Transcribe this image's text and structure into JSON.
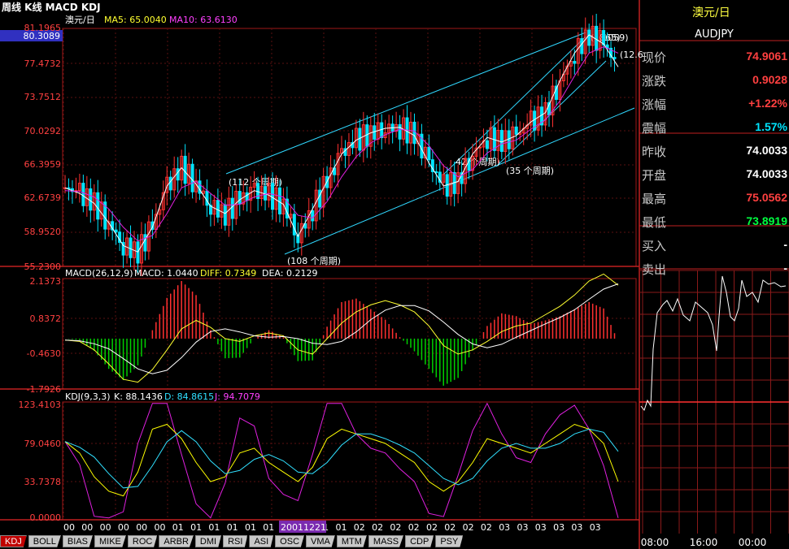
{
  "header": {
    "title": "周线 K线 MACD KDJ",
    "price_badge": "80.3089"
  },
  "colors": {
    "up": "#ff3030",
    "down": "#00e5ff",
    "grid": "#8b1a1a",
    "ma5": "#ffffff",
    "ma10": "#e020e0",
    "k": "#ffffff",
    "d": "#ffff00",
    "j": "#e020e0"
  },
  "price_panel": {
    "title": "澳元/日",
    "ma5_label": "MA5: 65.0040",
    "ma10_label": "MA10: 63.6130",
    "ticks": [
      "81.1965",
      "77.4732",
      "73.7512",
      "70.0292",
      "66.3959",
      "62.6739",
      "58.9520",
      "55.2300"
    ],
    "ylim": [
      55.23,
      81.1965
    ],
    "annotations": [
      "(112 个周期)",
      "(108 个周期)",
      "42 个周期)",
      "(35 个周期)",
      "(1865)",
      "(1059)",
      "(12.6"
    ]
  },
  "macd_panel": {
    "label": "MACD(26,12,9)",
    "macd_label": "MACD: 1.0440",
    "diff_label": "DIFF: 0.7349",
    "dea_label": "DEA: 0.2129",
    "ticks": [
      "2.1373",
      "0.8372",
      "-0.4630",
      "-1.7926"
    ],
    "ylim": [
      -1.7926,
      2.1373
    ]
  },
  "kdj_panel": {
    "label": "KDJ(9,3,3)",
    "k_label": "K: 88.1436",
    "d_label": "D: 84.8615",
    "j_label": "J: 94.7079",
    "ticks": [
      "123.4103",
      "79.0460",
      "33.7378",
      "0.0000"
    ],
    "ylim": [
      0,
      123.4103
    ]
  },
  "x_axis": {
    "labels": [
      "00",
      "00",
      "00",
      "00",
      "00",
      "00",
      "01",
      "01",
      "01",
      "01",
      "01",
      "01",
      "01",
      "01",
      "01",
      "01",
      "02",
      "02",
      "02",
      "02",
      "02",
      "02",
      "02",
      "02",
      "03",
      "03",
      "03",
      "03",
      "03",
      "03"
    ],
    "highlight": "20011221"
  },
  "tabs": [
    "KDJ",
    "BOLL",
    "BIAS",
    "MIKE",
    "ROC",
    "ARBR",
    "DMI",
    "RSI",
    "ASI",
    "OSC",
    "VMA",
    "MTM",
    "MASS",
    "CDP",
    "PSY"
  ],
  "quote": {
    "name": "澳元/日",
    "code": "AUDJPY",
    "rows": [
      {
        "k": "现价",
        "v": "74.9061",
        "c": "#ff4040"
      },
      {
        "k": "涨跌",
        "v": "0.9028",
        "c": "#ff4040"
      },
      {
        "k": "涨幅",
        "v": "+1.22%",
        "c": "#ff4040"
      },
      {
        "k": "震幅",
        "v": "1.57%",
        "c": "#00e5ff"
      },
      {
        "k": "昨收",
        "v": "74.0033",
        "c": "#ffffff"
      },
      {
        "k": "开盘",
        "v": "74.0033",
        "c": "#ffffff"
      },
      {
        "k": "最高",
        "v": "75.0562",
        "c": "#ff4040"
      },
      {
        "k": "最低",
        "v": "73.8919",
        "c": "#00ff40"
      },
      {
        "k": "买入",
        "v": "-",
        "c": "#ffffff"
      },
      {
        "k": "卖出",
        "v": "-",
        "c": "#ffffff"
      }
    ],
    "time_labels": [
      "08:00",
      "16:00",
      "00:00"
    ]
  },
  "chart_data": {
    "type": "line",
    "series": [
      {
        "name": "MA5",
        "values": [
          63.8,
          63.2,
          62.1,
          60.0,
          57.5,
          56.8,
          59.5,
          64.0,
          66.0,
          64.2,
          61.8,
          61.0,
          62.5,
          63.5,
          63.0,
          62.0,
          58.5,
          61.5,
          64.5,
          67.5,
          69.0,
          69.8,
          70.3,
          70.4,
          69.5,
          66.5,
          64.0,
          64.5,
          67.5,
          69.3,
          68.8,
          69.5,
          71.0,
          72.0,
          75.5,
          78.5,
          80.5,
          79.5,
          77.0
        ]
      },
      {
        "name": "MA10",
        "values": [
          63.5,
          63.4,
          62.8,
          61.5,
          59.5,
          58.0,
          58.6,
          61.0,
          63.8,
          64.5,
          63.2,
          61.9,
          62.0,
          62.8,
          63.2,
          62.8,
          60.8,
          60.5,
          62.3,
          65.0,
          67.2,
          68.7,
          69.6,
          70.2,
          70.0,
          68.4,
          66.2,
          65.0,
          65.8,
          67.6,
          68.6,
          69.0,
          70.2,
          71.2,
          73.3,
          76.0,
          78.5,
          79.2,
          78.5
        ]
      }
    ],
    "macd": {
      "diff": [
        -0.05,
        -0.1,
        -0.4,
        -0.9,
        -1.45,
        -1.55,
        -1.1,
        -0.4,
        0.35,
        0.65,
        0.4,
        0.0,
        -0.1,
        0.1,
        0.2,
        0.1,
        -0.4,
        -0.55,
        0.0,
        0.55,
        0.95,
        1.2,
        1.35,
        1.2,
        0.95,
        0.45,
        -0.25,
        -0.55,
        -0.4,
        -0.1,
        0.25,
        0.45,
        0.55,
        0.85,
        1.15,
        1.55,
        2.05,
        2.3,
        1.9
      ]
    },
    "kdj": {
      "k": [
        82,
        70,
        45,
        30,
        25,
        50,
        95,
        100,
        85,
        60,
        40,
        45,
        70,
        75,
        60,
        50,
        40,
        55,
        85,
        95,
        90,
        85,
        80,
        70,
        60,
        40,
        30,
        40,
        60,
        85,
        80,
        75,
        70,
        80,
        90,
        100,
        95,
        80,
        40
      ]
    }
  }
}
